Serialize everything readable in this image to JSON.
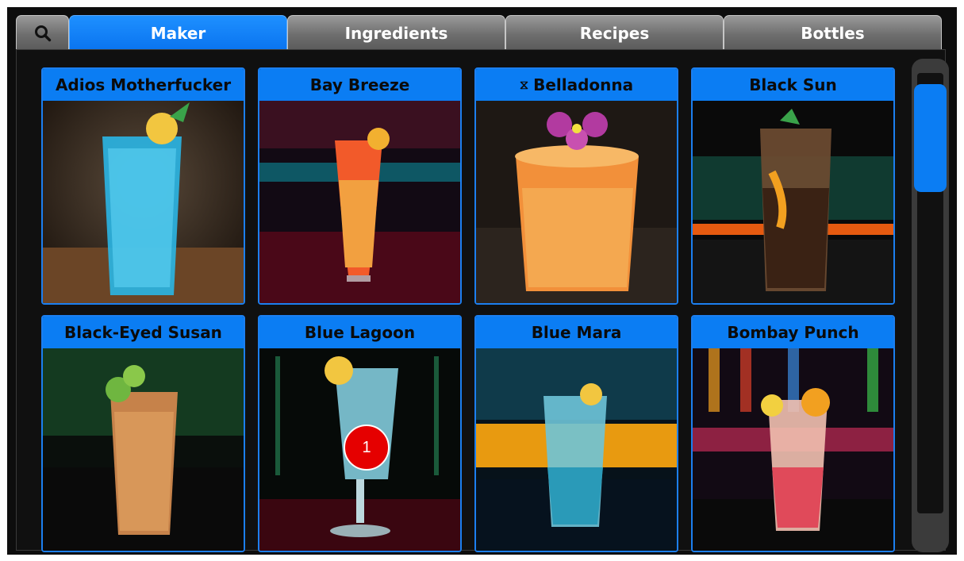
{
  "tabs": {
    "search_icon": "search-icon",
    "items": [
      {
        "label": "Maker",
        "active": true
      },
      {
        "label": "Ingredients",
        "active": false
      },
      {
        "label": "Recipes",
        "active": false
      },
      {
        "label": "Bottles",
        "active": false
      }
    ]
  },
  "cocktails": [
    {
      "name": "Adios Motherfucker",
      "icon": ""
    },
    {
      "name": "Bay Breeze",
      "icon": ""
    },
    {
      "name": "Belladonna",
      "icon": "⧖"
    },
    {
      "name": "Black Sun",
      "icon": ""
    },
    {
      "name": "Black-Eyed Susan",
      "icon": ""
    },
    {
      "name": "Blue Lagoon",
      "icon": ""
    },
    {
      "name": "Blue Mara",
      "icon": ""
    },
    {
      "name": "Bombay Punch",
      "icon": ""
    }
  ],
  "marker": {
    "label": "1"
  },
  "colors": {
    "accent": "#0b7df3",
    "background": "#0d0d0d",
    "tab_inactive": "#6e6e6e"
  }
}
